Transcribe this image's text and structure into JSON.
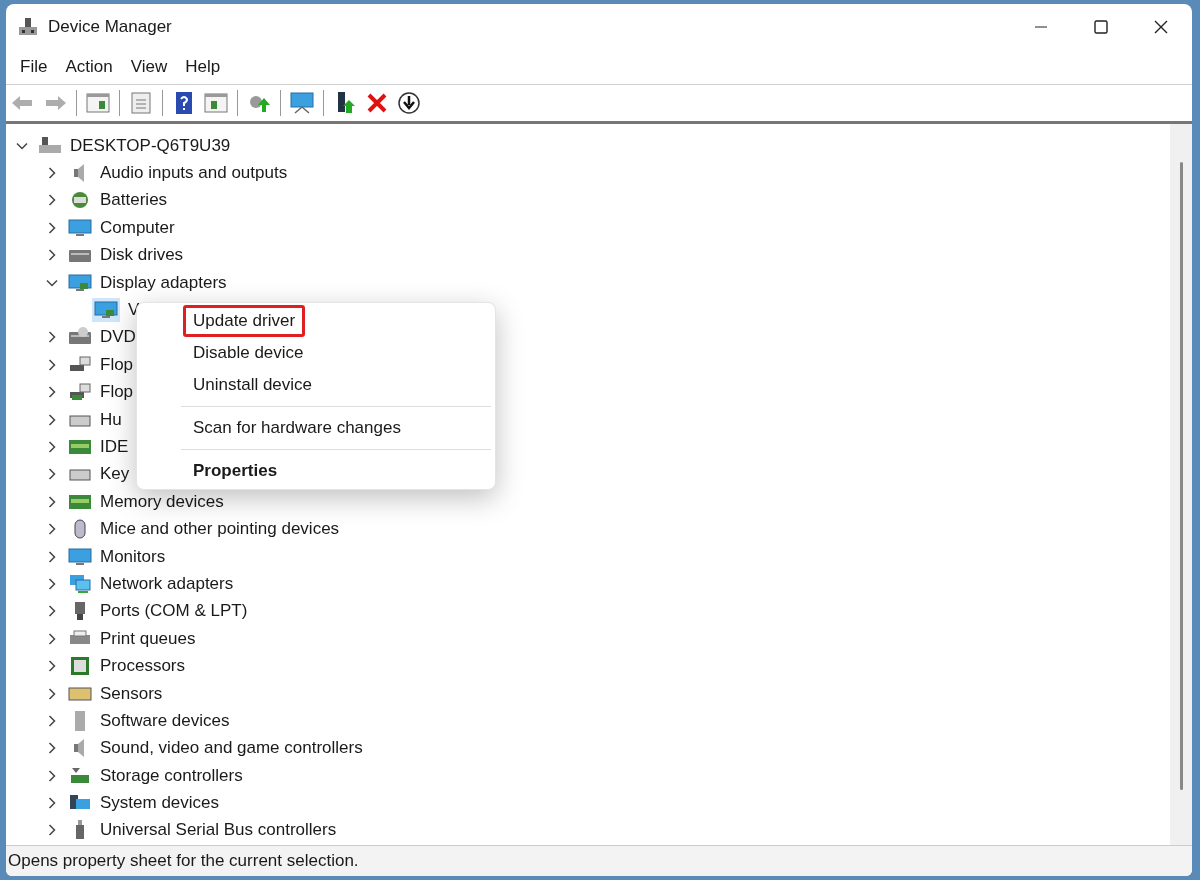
{
  "window": {
    "title": "Device Manager"
  },
  "menu_bar": [
    "File",
    "Action",
    "View",
    "Help"
  ],
  "toolbar": [
    {
      "kind": "back",
      "disabled": true
    },
    {
      "kind": "forward",
      "disabled": true
    },
    {
      "kind": "separator"
    },
    {
      "kind": "tree-pane",
      "disabled": false
    },
    {
      "kind": "separator"
    },
    {
      "kind": "properties",
      "disabled": false
    },
    {
      "kind": "separator"
    },
    {
      "kind": "help",
      "disabled": false
    },
    {
      "kind": "action-pane",
      "disabled": false
    },
    {
      "kind": "separator"
    },
    {
      "kind": "update",
      "disabled": false
    },
    {
      "kind": "separator"
    },
    {
      "kind": "scan",
      "disabled": false
    },
    {
      "kind": "separator"
    },
    {
      "kind": "enable",
      "disabled": false
    },
    {
      "kind": "uninstall",
      "disabled": false
    },
    {
      "kind": "disable",
      "disabled": false
    }
  ],
  "tree": {
    "label": "DESKTOP-Q6T9U39",
    "expanded": true,
    "children": [
      {
        "label": "Audio inputs and outputs",
        "expanded": false
      },
      {
        "label": "Batteries",
        "expanded": false
      },
      {
        "label": "Computer",
        "expanded": false
      },
      {
        "label": "Disk drives",
        "expanded": false
      },
      {
        "label": "Display adapters",
        "expanded": true,
        "children": [
          {
            "label": "V",
            "selected": true
          }
        ]
      },
      {
        "label": "DVD",
        "expanded": false
      },
      {
        "label": "Flop",
        "expanded": false
      },
      {
        "label": "Flop",
        "expanded": false
      },
      {
        "label": "Hu",
        "expanded": false
      },
      {
        "label": "IDE",
        "expanded": false
      },
      {
        "label": "Key",
        "expanded": false
      },
      {
        "label": "Memory devices",
        "expanded": false
      },
      {
        "label": "Mice and other pointing devices",
        "expanded": false
      },
      {
        "label": "Monitors",
        "expanded": false
      },
      {
        "label": "Network adapters",
        "expanded": false
      },
      {
        "label": "Ports (COM & LPT)",
        "expanded": false
      },
      {
        "label": "Print queues",
        "expanded": false
      },
      {
        "label": "Processors",
        "expanded": false
      },
      {
        "label": "Sensors",
        "expanded": false
      },
      {
        "label": "Software devices",
        "expanded": false
      },
      {
        "label": "Sound, video and game controllers",
        "expanded": false
      },
      {
        "label": "Storage controllers",
        "expanded": false
      },
      {
        "label": "System devices",
        "expanded": false
      },
      {
        "label": "Universal Serial Bus controllers",
        "expanded": false
      }
    ]
  },
  "context_menu": [
    {
      "kind": "item",
      "label": "Update driver",
      "highlighted": true,
      "default": false
    },
    {
      "kind": "item",
      "label": "Disable device",
      "highlighted": false,
      "default": false
    },
    {
      "kind": "item",
      "label": "Uninstall device",
      "highlighted": false,
      "default": false
    },
    {
      "kind": "separator"
    },
    {
      "kind": "item",
      "label": "Scan for hardware changes",
      "highlighted": false,
      "default": false
    },
    {
      "kind": "separator"
    },
    {
      "kind": "item",
      "label": "Properties",
      "highlighted": false,
      "default": true
    }
  ],
  "status_bar": "Opens property sheet for the current selection."
}
